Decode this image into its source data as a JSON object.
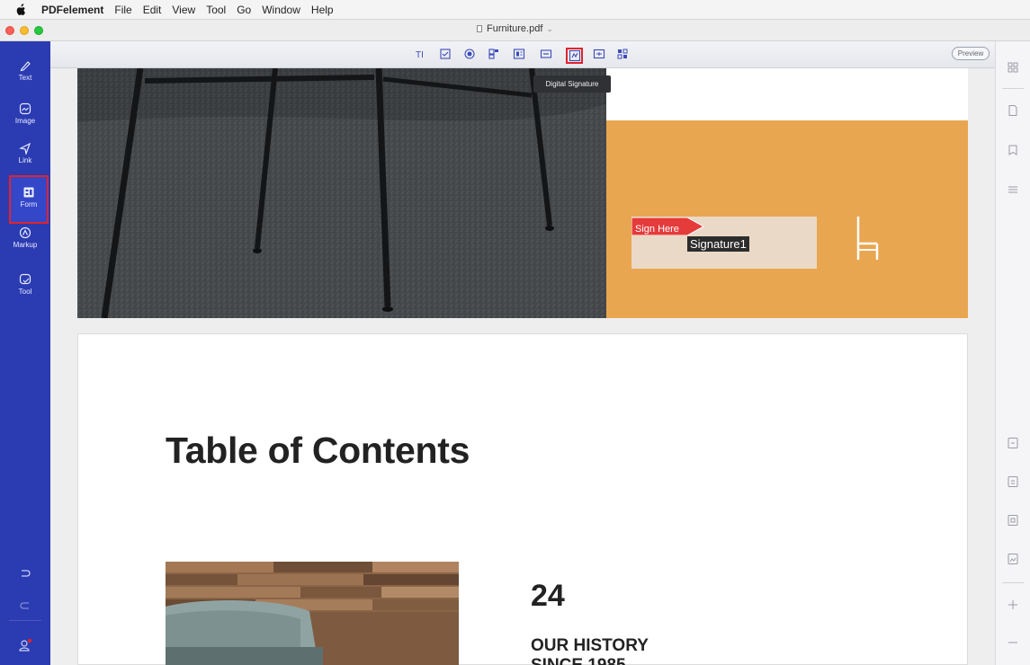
{
  "menubar": {
    "app_name": "PDFelement",
    "items": [
      "File",
      "Edit",
      "View",
      "Tool",
      "Go",
      "Window",
      "Help"
    ]
  },
  "window": {
    "title": "Furniture.pdf"
  },
  "left_sidebar": {
    "tools": [
      {
        "label": "Text",
        "icon": "pen-icon"
      },
      {
        "label": "Image",
        "icon": "image-icon"
      },
      {
        "label": "Link",
        "icon": "link-icon"
      },
      {
        "label": "Form",
        "icon": "form-icon"
      },
      {
        "label": "Markup",
        "icon": "markup-icon"
      },
      {
        "label": "Tool",
        "icon": "tool-icon"
      }
    ],
    "selected": "Form"
  },
  "toolbar": {
    "icons": [
      "text-field-icon",
      "checkbox-icon",
      "radio-button-icon",
      "combo-box-icon",
      "list-box-icon",
      "button-icon",
      "digital-signature-icon",
      "date-field-icon",
      "barcode-icon"
    ],
    "highlighted": "digital-signature-icon",
    "tooltip": "Digital Signature",
    "preview_label": "Preview"
  },
  "document": {
    "sign_here_label": "Sign Here",
    "signature_field_name": "Signature1",
    "toc_heading": "Table of Contents",
    "page_number": "24",
    "history_line1": "OUR HISTORY",
    "history_line2": "SINCE 1985"
  },
  "colors": {
    "sidebar": "#2b3bb2",
    "highlight": "#e0242c",
    "orange_panel": "#e9a650"
  }
}
